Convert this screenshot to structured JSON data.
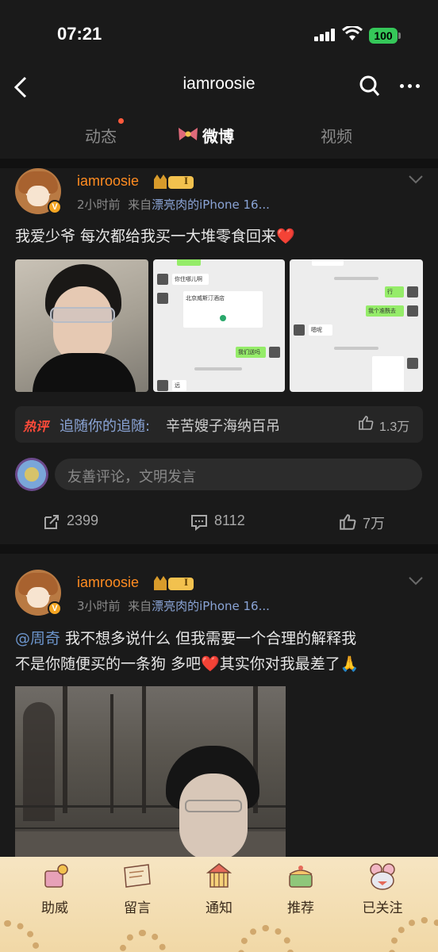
{
  "status_bar": {
    "time": "07:21",
    "battery": "100"
  },
  "nav": {
    "title": "iamroosie",
    "back_icon": "back-chevron-icon",
    "search_icon": "search-icon",
    "more_icon": "more-dots-icon"
  },
  "tabs": [
    {
      "label": "动态",
      "has_dot": true
    },
    {
      "label": "微博",
      "active": true
    },
    {
      "label": "视频"
    }
  ],
  "posts": [
    {
      "username": "iamroosie",
      "level_badge": "I",
      "verified_badge": "V",
      "time": "2小时前",
      "source_prefix": "来自",
      "source": "漂亮肉的iPhone 16...",
      "text": "我爱少爷 每次都给我买一大堆零食回来❤️",
      "chat_thumb_texts": [
        "你住哪儿啊",
        "北京威斯汀酒店",
        "我们送吗",
        "远",
        "行",
        "我个准酰去",
        "嗯呢"
      ],
      "hot_comment": {
        "tag": "热评",
        "user": "追随你的追随:",
        "text": "辛苦嫂子海纳百吊",
        "likes": "1.3万"
      },
      "comment_placeholder": "友善评论，文明发言",
      "actions": {
        "reposts": "2399",
        "comments": "8112",
        "likes": "7万"
      }
    },
    {
      "username": "iamroosie",
      "level_badge": "I",
      "verified_badge": "V",
      "time": "3小时前",
      "source_prefix": "来自",
      "source": "漂亮肉的iPhone 16...",
      "mention": "@周奇",
      "text_line1": " 我不想多说什么 但我需要一个合理的解释我",
      "text_line2": "不是你随便买的一条狗 多吧",
      "text_line2_end": "其实你对我最差了",
      "heart": "❤️",
      "emoji_end": "🙏"
    }
  ],
  "bottom_bar": [
    {
      "label": "助威",
      "icon": "cheer-icon"
    },
    {
      "label": "留言",
      "icon": "message-board-icon"
    },
    {
      "label": "通知",
      "icon": "carousel-notice-icon"
    },
    {
      "label": "推荐",
      "icon": "cake-recommend-icon"
    },
    {
      "label": "已关注",
      "icon": "followed-mouse-icon"
    }
  ],
  "colors": {
    "background": "#1a1a1a",
    "username": "#ff8c21",
    "link": "#8aa4d6",
    "hot_tag": "#ff4b3a",
    "bottom_bar": "#f6e5c2"
  }
}
